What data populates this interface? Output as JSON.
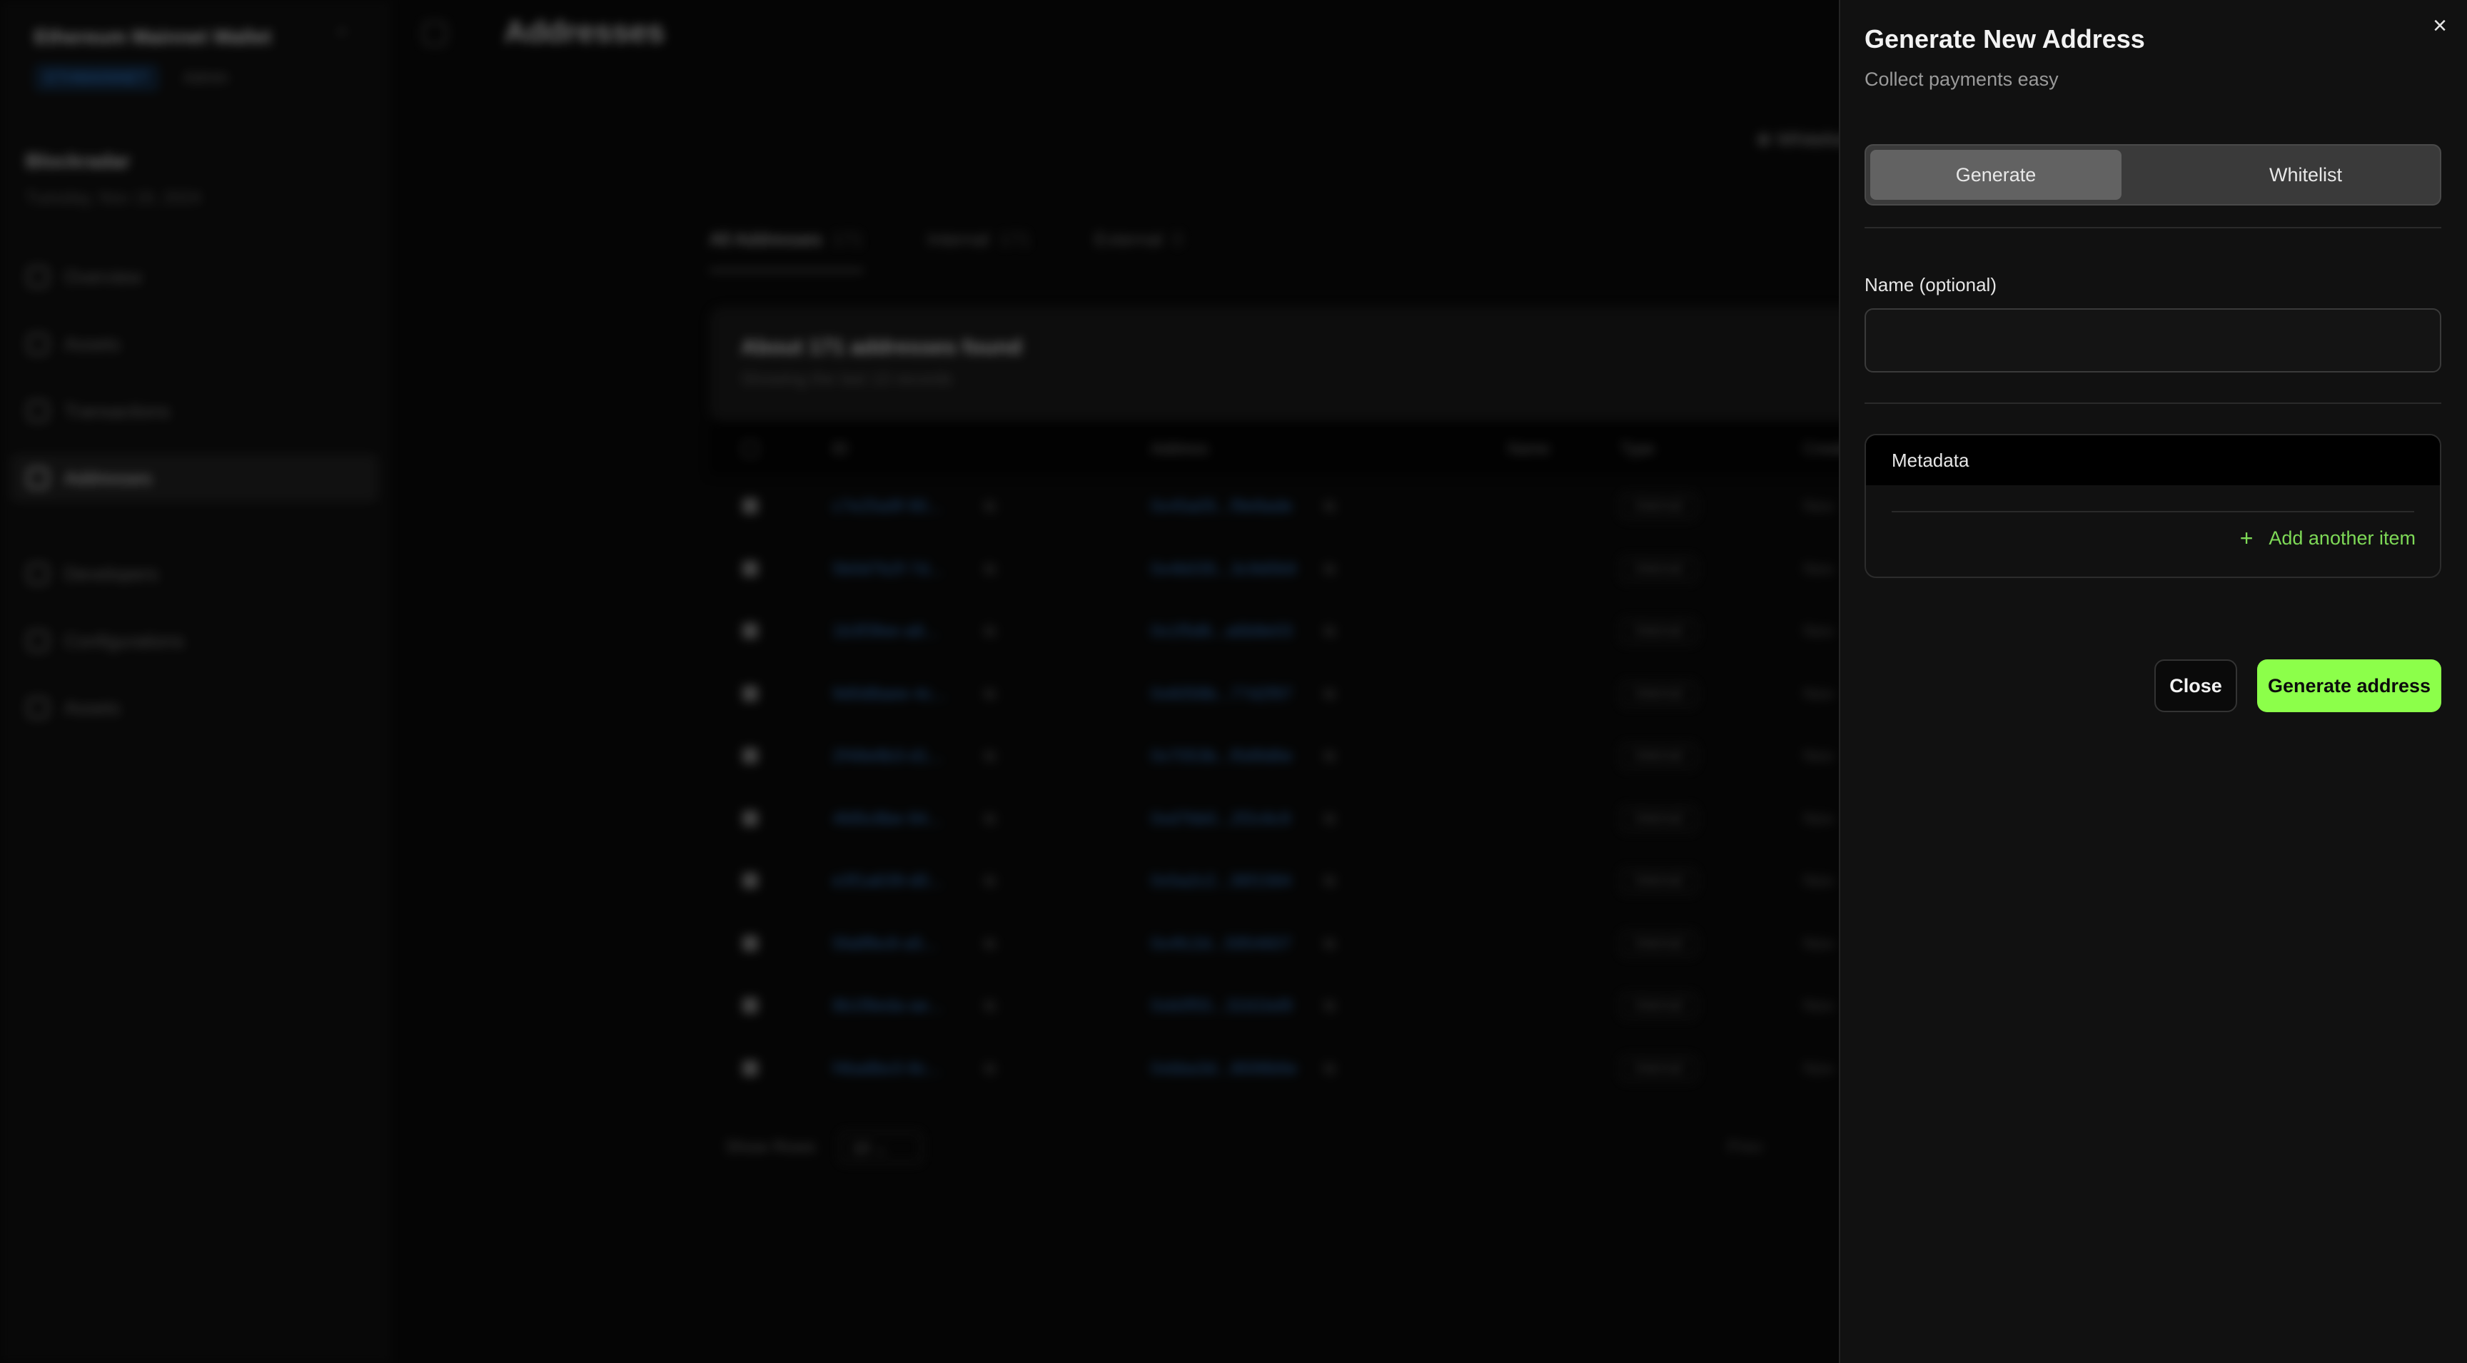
{
  "background": {
    "workspace": {
      "name": "Ethereum Mainnet Wallet",
      "badges": [
        "ETHMAINNET",
        "Admin"
      ]
    },
    "greeting": "Blockradar",
    "date": "Tuesday, Nov 19, 2024",
    "nav_primary": [
      "Overview",
      "Assets",
      "Transactions",
      "Addresses"
    ],
    "nav_secondary": [
      "Developers",
      "Configurations",
      "Assets"
    ],
    "page_title": "Addresses",
    "whitelist_button": "Whitelist",
    "tabs": [
      {
        "label": "All Addresses",
        "count": "171"
      },
      {
        "label": "Internal",
        "count": "171"
      },
      {
        "label": "External",
        "count": "0"
      }
    ],
    "summary": {
      "title": "About 171 addresses found",
      "subtitle": "Showing the last 10 records"
    },
    "table": {
      "headers": [
        "ID",
        "Address",
        "Name",
        "Type",
        "Created"
      ],
      "rows": [
        {
          "id": "c7e25a9f-90...",
          "address": "0x45a05...f9e8ade",
          "type": "Internal",
          "created": "Nov"
        },
        {
          "id": "5b0d7b2f-7d...",
          "address": "0x4b035...3c9d0b9",
          "type": "Internal",
          "created": "Nov"
        },
        {
          "id": "1b3f3fee-a8...",
          "address": "0x1f5d6...a6b8e03",
          "type": "Internal",
          "created": "Nov"
        },
        {
          "id": "9d0d8aee-4c...",
          "address": "0x6058b...77d2f97",
          "type": "Internal",
          "created": "Nov"
        },
        {
          "id": "2f48e8b3-d1...",
          "address": "0x7053b...f0d9d6e",
          "type": "Internal",
          "created": "Nov"
        },
        {
          "id": "4fd5c8be-94...",
          "address": "0xd7bb0...2f2c6c9",
          "type": "Internal",
          "created": "Nov"
        },
        {
          "id": "e3f1a639-d0...",
          "address": "0x5a2c2...36f1584",
          "type": "Internal",
          "created": "Nov"
        },
        {
          "id": "5fa8fbc8-a5...",
          "address": "0x4fc2d...5954607",
          "type": "Internal",
          "created": "Nov"
        },
        {
          "id": "8b1f8eda-ae...",
          "address": "0xb0f55...32d1bd9",
          "type": "Internal",
          "created": "Nov"
        },
        {
          "id": "f4ba8bc0-8c...",
          "address": "0xbba3d...8698b6e",
          "type": "Internal",
          "created": "Nov"
        }
      ]
    },
    "footer": {
      "rows_label": "Show Rows",
      "rows_value": "10",
      "pager": "Prev"
    }
  },
  "drawer": {
    "title": "Generate New Address",
    "subtitle": "Collect payments easy",
    "segments": [
      "Generate",
      "Whitelist"
    ],
    "selected_segment": "Generate",
    "name_label": "Name (optional)",
    "name_value": "",
    "name_placeholder": "",
    "metadata_title": "Metadata",
    "add_item_label": "Add another item",
    "close_button": "Close",
    "generate_button": "Generate address",
    "close_icon": "close-icon",
    "accent_color": "#8cff4a"
  }
}
